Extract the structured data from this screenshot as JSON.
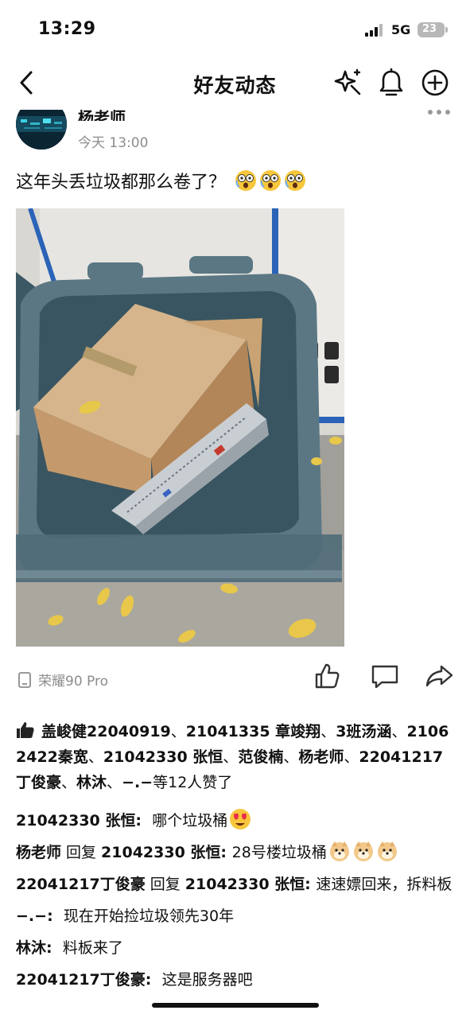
{
  "status_bar": {
    "time": "13:29",
    "network": "5G",
    "battery": "23"
  },
  "nav": {
    "title": "好友动态"
  },
  "post": {
    "author": "杨老师",
    "time": "今天 13:00",
    "text": "这年头丢垃圾都那么卷了？",
    "device": "荣耀90 Pro"
  },
  "likes": {
    "names": [
      "盖峻健22040919",
      "21041335 章竣翔",
      "3班汤涵",
      "21062422秦宽",
      "21042330 张恒",
      "范俊楠",
      "杨老师",
      "22041217丁俊豪",
      "林沐",
      "−.−"
    ],
    "separator": "、",
    "suffix": "等12人赞了"
  },
  "comments": [
    {
      "author": "21042330 张恒",
      "reply_word": "",
      "target": "",
      "text": "哪个垃圾桶"
    },
    {
      "author": "杨老师",
      "reply_word": "回复",
      "target": "21042330 张恒",
      "text": "28号楼垃圾桶"
    },
    {
      "author": "22041217丁俊豪",
      "reply_word": "回复",
      "target": "21042330 张恒",
      "text": "速速嫖回来，拆料板"
    },
    {
      "author": "−.−",
      "reply_word": "",
      "target": "",
      "text": "现在开始捡垃圾领先30年"
    },
    {
      "author": "林沐",
      "reply_word": "",
      "target": "",
      "text": "料板来了"
    },
    {
      "author": "22041217丁俊豪",
      "reply_word": "",
      "target": "",
      "text": "这是服务器吧"
    }
  ],
  "icons": {
    "back": "back-chevron-icon",
    "sparkle": "sparkle-icon",
    "bell": "bell-icon",
    "add": "add-circle-icon",
    "more": "more-dots-icon",
    "like": "thumbs-up-icon",
    "comment": "comment-bubble-icon",
    "share": "share-arrow-icon",
    "device": "phone-icon"
  },
  "colors": {
    "secondary_text": "#8c8c8c",
    "text": "#111111",
    "background": "#ffffff"
  }
}
